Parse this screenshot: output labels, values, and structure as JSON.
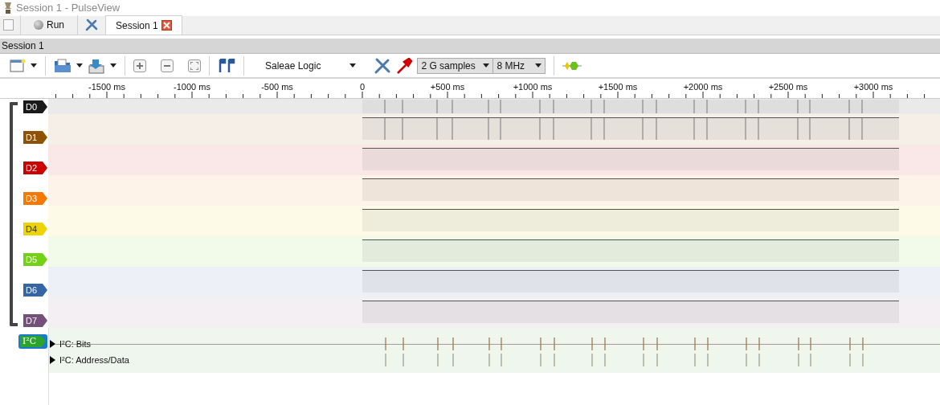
{
  "window": {
    "title": "Session 1 - PulseView"
  },
  "main_toolbar": {
    "run_label": "Run"
  },
  "tabs": [
    {
      "label": "Session 1",
      "selected": true
    }
  ],
  "session_header": "Session 1",
  "toolbar": {
    "device": "Saleae Logic",
    "sample_count": "2 G samples",
    "sample_rate": "8 MHz"
  },
  "ruler": {
    "labels": [
      "-1500 ms",
      "-1000 ms",
      "-500 ms",
      "0",
      "+500 ms",
      "+1000 ms",
      "+1500 ms",
      "+2000 ms",
      "+2500 ms",
      "+3000 ms"
    ]
  },
  "channels": [
    {
      "name": "D0",
      "color": "#1a1a1a"
    },
    {
      "name": "D1",
      "color": "#8f5202"
    },
    {
      "name": "D2",
      "color": "#cc0000"
    },
    {
      "name": "D3",
      "color": "#f57900"
    },
    {
      "name": "D4",
      "color": "#edd400"
    },
    {
      "name": "D5",
      "color": "#73d216"
    },
    {
      "name": "D6",
      "color": "#3465a4"
    },
    {
      "name": "D7",
      "color": "#75507b"
    }
  ],
  "decoder": {
    "name": "I²C",
    "selected": true,
    "rows": [
      {
        "label": "I²C: Bits",
        "expanded": false
      },
      {
        "label": "I²C: Address/Data",
        "expanded": false
      }
    ]
  }
}
